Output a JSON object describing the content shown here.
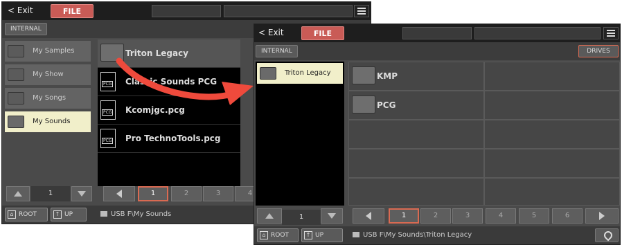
{
  "window1": {
    "exit_label": "< Exit",
    "file_label": "FILE",
    "internal_label": "INTERNAL",
    "left_items": [
      {
        "label": "My Samples"
      },
      {
        "label": "My Show"
      },
      {
        "label": "My Songs"
      },
      {
        "label": "My Sounds",
        "selected": true
      }
    ],
    "files": [
      {
        "label": "Triton Legacy",
        "type": "folder"
      },
      {
        "label": "Classic Sounds PCG",
        "type": "pcg"
      },
      {
        "label": "Kcomjgc.pcg",
        "type": "pcg"
      },
      {
        "label": "Pro TechnoTools.pcg",
        "type": "pcg"
      }
    ],
    "left_page_num": "1",
    "pages": [
      "1",
      "2",
      "3",
      "4"
    ],
    "root_label": "ROOT",
    "up_label": "UP",
    "path": "USB F\\My Sounds"
  },
  "window2": {
    "exit_label": "< Exit",
    "file_label": "FILE",
    "internal_label": "INTERNAL",
    "drives_label": "DRIVES",
    "left_items": [
      {
        "label": "Triton Legacy",
        "selected": true
      }
    ],
    "files": [
      {
        "label": "KMP",
        "type": "folder"
      },
      {
        "label": "PCG",
        "type": "folder"
      }
    ],
    "left_page_num": "1",
    "pages": [
      "1",
      "2",
      "3",
      "4",
      "5",
      "6"
    ],
    "root_label": "ROOT",
    "up_label": "UP",
    "path": "USB F\\My Sounds\\Triton Legacy"
  },
  "colors": {
    "accent": "#d96a52",
    "file_button": "#c95b56",
    "selection": "#f1efca",
    "arrow": "#ef4a3c"
  },
  "icons": [
    "menu-icon",
    "folder-icon",
    "pcg-file-icon",
    "home-icon",
    "up-icon",
    "location-pin-icon",
    "arrow-left-icon",
    "arrow-right-icon",
    "arrow-up-icon",
    "arrow-down-icon"
  ]
}
